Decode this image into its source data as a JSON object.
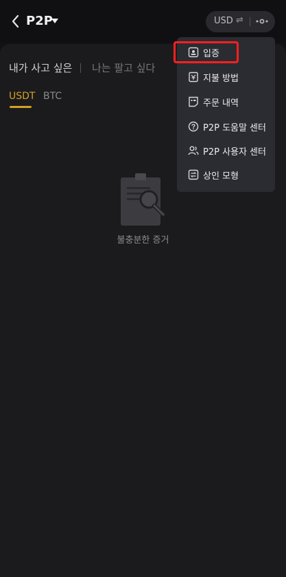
{
  "header": {
    "title": "P2P",
    "currency": "USD",
    "swap_glyph": "⇌",
    "icons": {
      "back": "chevron-left-icon",
      "dropdown": "caret-down-icon",
      "more": "more-icon"
    }
  },
  "trade_tabs": [
    "내가 사고 싶은",
    "나는 팔고 싶다"
  ],
  "coin_tabs": {
    "active": "USDT",
    "other": "BTC",
    "accent_color": "#d6a21e"
  },
  "empty_state": {
    "text": "불충분한 증거",
    "icon": "clipboard-search-icon"
  },
  "menu": {
    "items": [
      {
        "label": "입증",
        "icon": "id-badge-icon",
        "highlighted": true
      },
      {
        "label": "지불 방법",
        "icon": "wallet-icon"
      },
      {
        "label": "주문 내역",
        "icon": "order-list-icon"
      },
      {
        "label": "P2P 도움말 센터",
        "icon": "help-circle-icon"
      },
      {
        "label": "P2P 사용자 센터",
        "icon": "users-icon"
      },
      {
        "label": "상인 모형",
        "icon": "merchant-icon"
      }
    ],
    "highlight_color": "#ff2020"
  }
}
